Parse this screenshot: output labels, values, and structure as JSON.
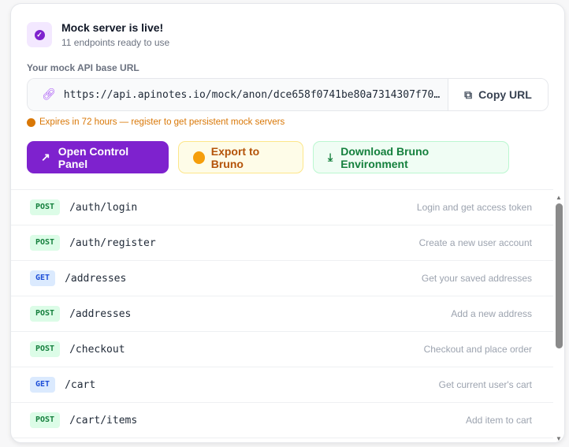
{
  "header": {
    "title": "Mock server is live!",
    "subtitle": "11 endpoints ready to use",
    "icon": "check-circle-icon"
  },
  "url": {
    "label": "Your mock API base URL",
    "value": "https://api.apinotes.io/mock/anon/dce658f0741be80a7314307f70…",
    "copy_label": "Copy URL"
  },
  "expiry": "Expires in 72 hours — register to get persistent mock servers",
  "actions": {
    "open": "Open Control Panel",
    "export": "Export to Bruno",
    "download": "Download Bruno Environment"
  },
  "colors": {
    "accent": "#7e22ce",
    "post": "#15803d",
    "get": "#1d4ed8",
    "warning": "#d97706"
  },
  "endpoints": [
    {
      "method": "POST",
      "path": "/auth/login",
      "desc": "Login and get access token"
    },
    {
      "method": "POST",
      "path": "/auth/register",
      "desc": "Create a new user account"
    },
    {
      "method": "GET",
      "path": "/addresses",
      "desc": "Get your saved addresses"
    },
    {
      "method": "POST",
      "path": "/addresses",
      "desc": "Add a new address"
    },
    {
      "method": "POST",
      "path": "/checkout",
      "desc": "Checkout and place order"
    },
    {
      "method": "GET",
      "path": "/cart",
      "desc": "Get current user's cart"
    },
    {
      "method": "POST",
      "path": "/cart/items",
      "desc": "Add item to cart"
    }
  ]
}
